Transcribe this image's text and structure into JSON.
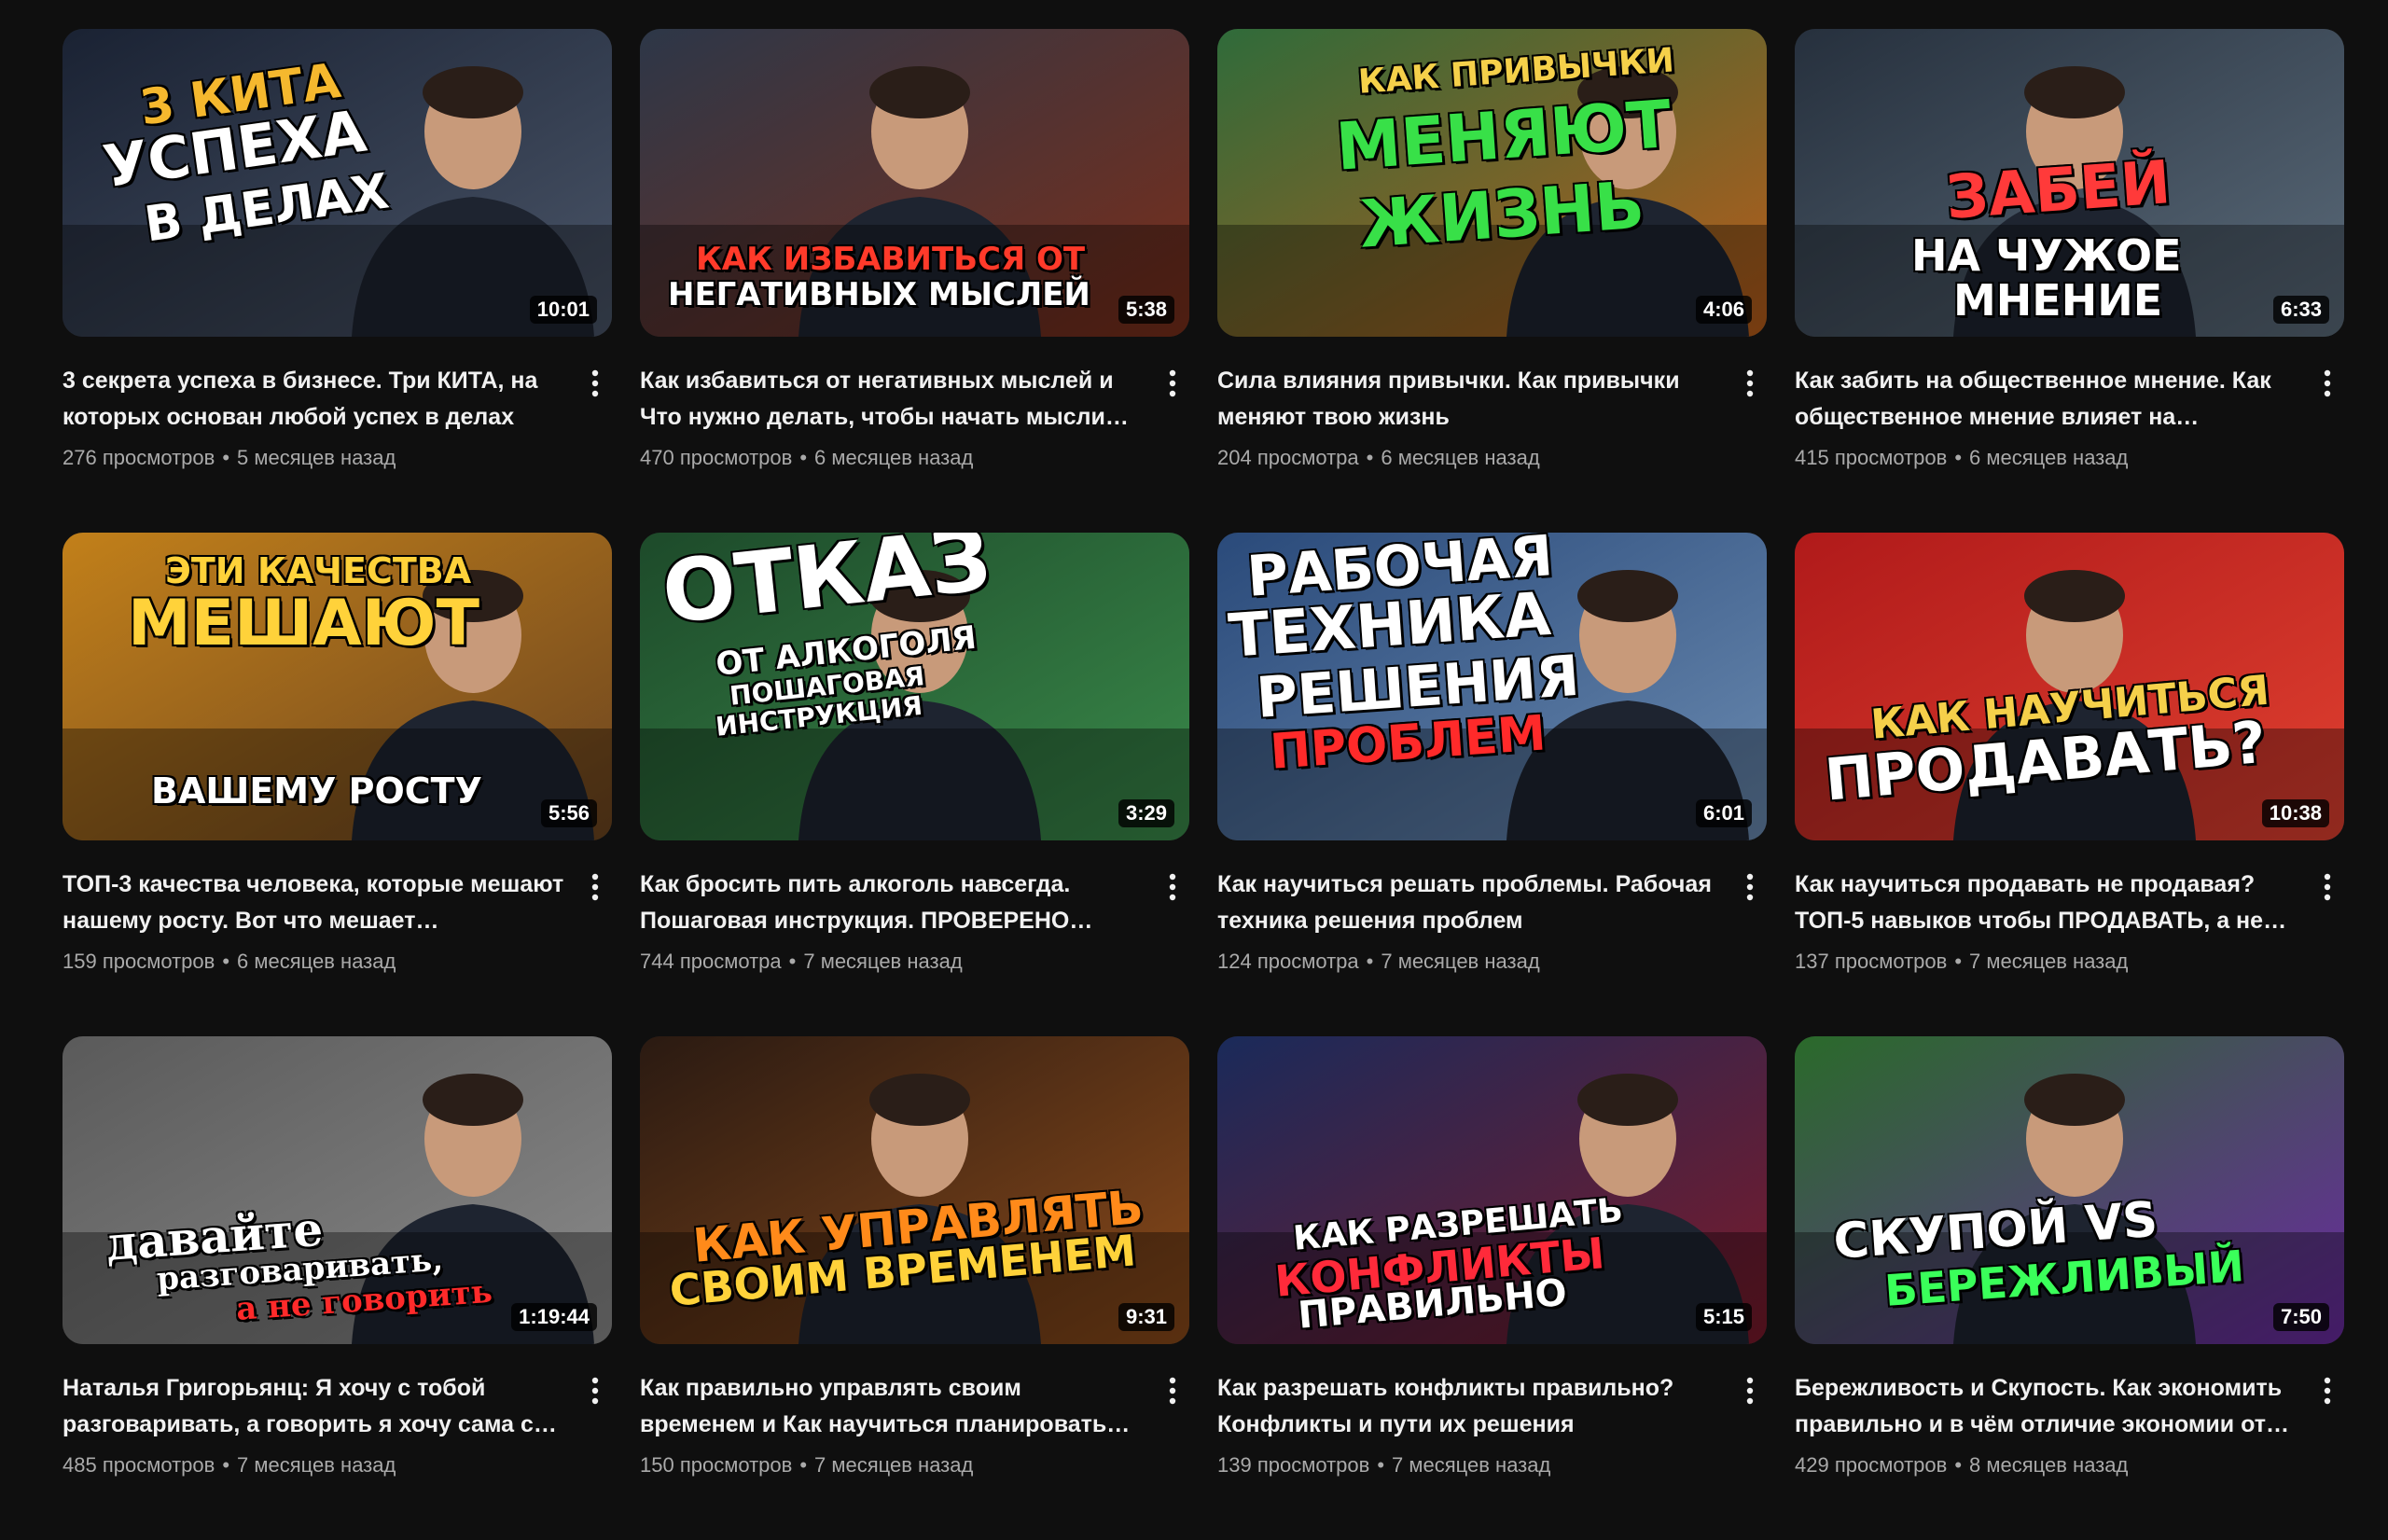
{
  "colors": {
    "background": "#0f0f0f",
    "title_text": "#f1f1f1",
    "meta_text": "#aaaaaa",
    "duration_bg": "#000000"
  },
  "menu_icon": "more-vertical-icon",
  "videos": [
    {
      "title": "3 секрета успеха в бизнесе. Три КИТА, на которых основан любой успех в делах",
      "views": "276 просмотров",
      "age": "5 месяцев назад",
      "duration": "10:01",
      "thumb_lines": [
        "3 КИТА",
        "УСПЕХА",
        "В ДЕЛАХ"
      ],
      "thumb_colors": [
        "#1a2233",
        "#4a5568"
      ]
    },
    {
      "title": "Как избавиться от негативных мыслей и Что нужно делать, чтобы начать мысли…",
      "views": "470 просмотров",
      "age": "6 месяцев назад",
      "duration": "5:38",
      "thumb_lines": [
        "КАК ИЗБАВИТЬСЯ ОТ",
        "НЕГАТИВНЫХ МЫСЛЕЙ"
      ],
      "thumb_colors": [
        "#2d3748",
        "#7a2e1a"
      ]
    },
    {
      "title": "Сила влияния привычки. Как привычки меняют твою жизнь",
      "views": "204 просмотра",
      "age": "6 месяцев назад",
      "duration": "4:06",
      "thumb_lines": [
        "КАК ПРИВЫЧКИ",
        "МЕНЯЮТ",
        "ЖИЗНЬ"
      ],
      "thumb_colors": [
        "#2f6b3a",
        "#b85c1a"
      ]
    },
    {
      "title": "Как забить на общественное мнение. Как общественное мнение влияет на…",
      "views": "415 просмотров",
      "age": "6 месяцев назад",
      "duration": "6:33",
      "thumb_lines": [
        "ЗАБЕЙ",
        "НА ЧУЖОЕ",
        "МНЕНИЕ"
      ],
      "thumb_colors": [
        "#26303d",
        "#5b6b7a"
      ]
    },
    {
      "title": "ТОП-3 качества человека, которые мешают нашему росту. Вот что мешает…",
      "views": "159 просмотров",
      "age": "6 месяцев назад",
      "duration": "5:56",
      "thumb_lines": [
        "ЭТИ КАЧЕСТВА",
        "МЕШАЮТ",
        "ВАШЕМУ РОСТУ"
      ],
      "thumb_colors": [
        "#c2801a",
        "#6b4420"
      ]
    },
    {
      "title": "Как бросить пить алкоголь навсегда. Пошаговая инструкция. ПРОВЕРЕНО…",
      "views": "744 просмотра",
      "age": "7 месяцев назад",
      "duration": "3:29",
      "thumb_lines": [
        "ОТКАЗ",
        "ОТ АЛКОГОЛЯ",
        "ПОШАГОВАЯ",
        "ИНСТРУКЦИЯ"
      ],
      "thumb_colors": [
        "#1d4a2a",
        "#3a8a4a"
      ]
    },
    {
      "title": "Как научиться решать проблемы. Рабочая техника решения проблем",
      "views": "124 просмотра",
      "age": "7 месяцев назад",
      "duration": "6:01",
      "thumb_lines": [
        "РАБОЧАЯ",
        "ТЕХНИКА",
        "РЕШЕНИЯ",
        "ПРОБЛЕМ"
      ],
      "thumb_colors": [
        "#2a4a7a",
        "#6a8ab0"
      ]
    },
    {
      "title": "Как научиться продавать не продавая? ТОП-5 навыков чтобы ПРОДАВАТЬ, а не…",
      "views": "137 просмотров",
      "age": "7 месяцев назад",
      "duration": "10:38",
      "thumb_lines": [
        "КАК НАУЧИТЬСЯ",
        "ПРОДАВАТЬ?"
      ],
      "thumb_colors": [
        "#b01a1a",
        "#e04030"
      ]
    },
    {
      "title": "Наталья Григорьянц: Я хочу с тобой разговаривать, а говорить я хочу сама с…",
      "views": "485 просмотров",
      "age": "7 месяцев назад",
      "duration": "1:19:44",
      "thumb_lines": [
        "давайте",
        "разговаривать,",
        "а не говорить"
      ],
      "thumb_colors": [
        "#5a5a5a",
        "#8a8a8a"
      ]
    },
    {
      "title": "Как правильно управлять своим временем и Как научиться планировать…",
      "views": "150 просмотров",
      "age": "7 месяцев назад",
      "duration": "9:31",
      "thumb_lines": [
        "КАК УПРАВЛЯТЬ",
        "СВОИМ ВРЕМЕНЕМ"
      ],
      "thumb_colors": [
        "#2a1a12",
        "#8a4a1a"
      ]
    },
    {
      "title": "Как разрешать конфликты правильно? Конфликты и пути их решения",
      "views": "139 просмотров",
      "age": "7 месяцев назад",
      "duration": "5:15",
      "thumb_lines": [
        "КАК РАЗРЕШАТЬ",
        "КОНФЛИКТЫ",
        "ПРАВИЛЬНО"
      ],
      "thumb_colors": [
        "#1a2a5a",
        "#7a1a2a"
      ]
    },
    {
      "title": "Бережливость и Скупость. Как экономить правильно и в чём отличие экономии от…",
      "views": "429 просмотров",
      "age": "8 месяцев назад",
      "duration": "7:50",
      "thumb_lines": [
        "СКУПОЙ VS",
        "БЕРЕЖЛИВЫЙ"
      ],
      "thumb_colors": [
        "#2a6a2a",
        "#6a2aa0"
      ]
    }
  ]
}
